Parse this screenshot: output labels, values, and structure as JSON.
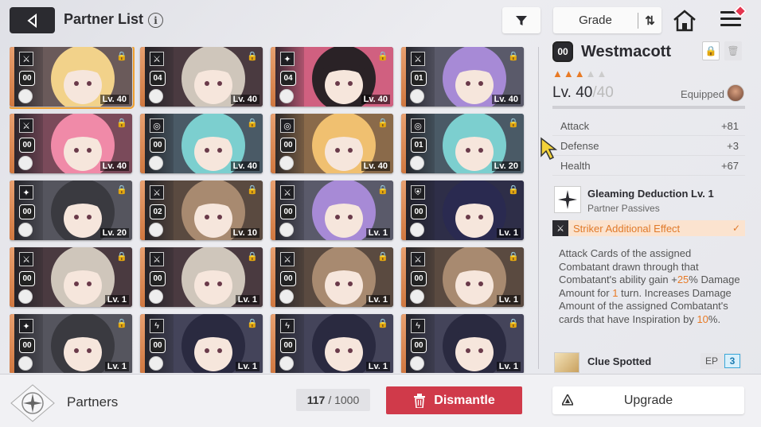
{
  "header": {
    "title": "Partner List",
    "info": "i",
    "grade_label": "Grade"
  },
  "cards": [
    {
      "code": "00",
      "lv": "Lv. 40",
      "role": "striker",
      "selected": true,
      "hair": "#f2d28a",
      "bg": "#6a5a5a"
    },
    {
      "code": "04",
      "lv": "Lv. 40",
      "role": "striker",
      "hair": "#cfc6bb",
      "bg": "#4a3a40"
    },
    {
      "code": "04",
      "lv": "Lv. 40",
      "role": "support",
      "hair": "#2a2226",
      "bg": "#d06080"
    },
    {
      "code": "01",
      "lv": "Lv. 40",
      "role": "striker",
      "hair": "#a78ad6",
      "bg": "#5a5a6a"
    },
    {
      "code": "00",
      "lv": "Lv. 40",
      "role": "striker",
      "hair": "#f08aa8",
      "bg": "#7a4a5a"
    },
    {
      "code": "00",
      "lv": "Lv. 40",
      "role": "target",
      "hair": "#7ccfcf",
      "bg": "#4a5a66"
    },
    {
      "code": "00",
      "lv": "Lv. 40",
      "role": "target",
      "hair": "#f0c070",
      "bg": "#8a6a4a"
    },
    {
      "code": "01",
      "lv": "Lv. 20",
      "role": "target",
      "hair": "#7ccfcf",
      "bg": "#4a5a66"
    },
    {
      "code": "00",
      "lv": "Lv. 20",
      "role": "support",
      "hair": "#3a3a40",
      "bg": "#55555e"
    },
    {
      "code": "02",
      "lv": "Lv. 10",
      "role": "striker",
      "hair": "#a88a70",
      "bg": "#5a4a40"
    },
    {
      "code": "00",
      "lv": "Lv. 1",
      "role": "striker",
      "hair": "#a78ad6",
      "bg": "#5a5a6a"
    },
    {
      "code": "00",
      "lv": "Lv. 1",
      "role": "shield",
      "hair": "#2a2a50",
      "bg": "#2e2e48"
    },
    {
      "code": "00",
      "lv": "Lv. 1",
      "role": "striker",
      "hair": "#cfc6bb",
      "bg": "#4a3a40"
    },
    {
      "code": "00",
      "lv": "Lv. 1",
      "role": "striker",
      "hair": "#cfc6bb",
      "bg": "#4a3a40"
    },
    {
      "code": "00",
      "lv": "Lv. 1",
      "role": "striker",
      "hair": "#a88a70",
      "bg": "#5a4a40"
    },
    {
      "code": "00",
      "lv": "Lv. 1",
      "role": "striker",
      "hair": "#a88a70",
      "bg": "#5a4a40"
    },
    {
      "code": "00",
      "lv": "Lv. 1",
      "role": "support",
      "hair": "#3a3a40",
      "bg": "#55555e"
    },
    {
      "code": "00",
      "lv": "Lv. 1",
      "role": "bolt",
      "hair": "#2a2a40",
      "bg": "#44445a"
    },
    {
      "code": "00",
      "lv": "Lv. 1",
      "role": "bolt",
      "hair": "#2a2a40",
      "bg": "#44445a"
    },
    {
      "code": "00",
      "lv": "Lv. 1",
      "role": "bolt",
      "hair": "#2a2a40",
      "bg": "#44445a"
    }
  ],
  "detail": {
    "code": "00",
    "name": "Westmacott",
    "stars_filled": 3,
    "stars_total": 5,
    "lv_prefix": "Lv. 40",
    "lv_max": "/40",
    "equipped": "Equipped",
    "stats": [
      {
        "label": "Attack",
        "value": "+81"
      },
      {
        "label": "Defense",
        "value": "+3"
      },
      {
        "label": "Health",
        "value": "+67"
      }
    ],
    "passive_name": "Gleaming Deduction Lv. 1",
    "passive_sub": "Partner Passives",
    "striker_effect": "Striker Additional Effect",
    "desc_1": "Attack Cards of the assigned Combatant drawn through that Combatant's ability gain +",
    "desc_hl1": "25",
    "desc_2": "% Damage Amount for ",
    "desc_hl2": "1",
    "desc_3": " turn. Increases Damage Amount of the assigned Combatant's cards that have Inspiration by ",
    "desc_hl3": "10",
    "desc_4": "%.",
    "clue_name": "Clue Spotted",
    "ep_label": "EP",
    "ep_value": "3"
  },
  "footer": {
    "partners_label": "Partners",
    "count_current": "117",
    "count_total": "/ 1000",
    "dismantle_label": "Dismantle",
    "upgrade_label": "Upgrade"
  },
  "colors": {
    "accent_orange": "#e87a25",
    "dismantle_red": "#d03a4a",
    "selected_outline": "#f0a030"
  }
}
